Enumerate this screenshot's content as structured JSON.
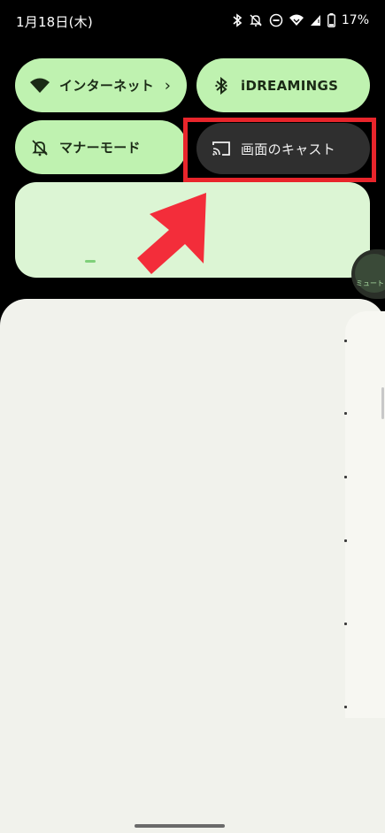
{
  "status_bar": {
    "date": "1月18日(木)",
    "battery": "17%",
    "icons": [
      "bluetooth-icon",
      "mute-icon",
      "do-not-disturb-icon",
      "wifi-icon",
      "signal-icon",
      "battery-icon"
    ]
  },
  "quick_settings": {
    "tiles": [
      {
        "label": "インターネット",
        "icon": "wifi-icon",
        "has_chevron": true,
        "chevron": "›"
      },
      {
        "label": "iDREAMINGS",
        "icon": "bluetooth-icon"
      },
      {
        "label": "マナーモード",
        "icon": "bell-off-icon"
      },
      {
        "label": "画面のキャスト",
        "icon": "cast-icon"
      }
    ]
  },
  "annotation": {
    "highlight_color": "#e8252b",
    "arrow_color": "#f32d3a"
  },
  "side_chip": {
    "label": "ミュート"
  },
  "colors": {
    "tile_active": "#bff2b0",
    "tile_inactive": "#2f2f2f",
    "media_panel": "#dcf5d4",
    "sheet": "#f1f2ec"
  }
}
